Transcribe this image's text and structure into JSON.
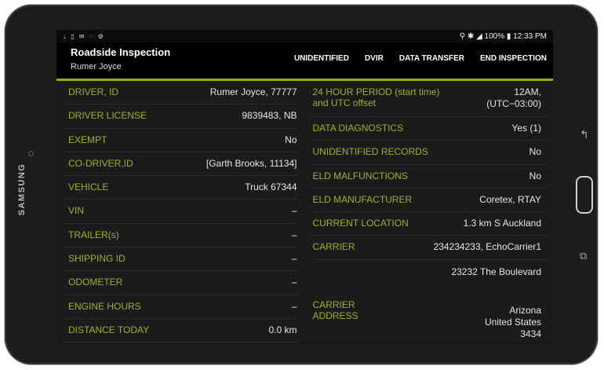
{
  "device": {
    "brand": "SAMSUNG"
  },
  "statusbar": {
    "left": "↓ ▯ ✉ ◌ ⚙",
    "right": "⚲ ✱ ὏6 ◢ 100% ▮ 12:33 PM"
  },
  "app": {
    "title": "Roadside Inspection",
    "subtitle": "Rumer Joyce",
    "actions": [
      "UNIDENTIFIED",
      "DVIR",
      "DATA TRANSFER",
      "END INSPECTION"
    ]
  },
  "left_rows": [
    {
      "label": "DRIVER, ID",
      "value": "Rumer Joyce, 77777"
    },
    {
      "label": "DRIVER LICENSE",
      "value": "9839483, NB"
    },
    {
      "label": "EXEMPT",
      "value": "No"
    },
    {
      "label": "CO-DRIVER,ID",
      "value": "[Garth Brooks, 11134]"
    },
    {
      "label": "VEHICLE",
      "value": "Truck 67344"
    },
    {
      "label": "VIN",
      "value": "–"
    },
    {
      "label": "TRAILER(s)",
      "value": "–"
    },
    {
      "label": "SHIPPING ID",
      "value": "–"
    },
    {
      "label": "ODOMETER",
      "value": "–"
    },
    {
      "label": "ENGINE HOURS",
      "value": "–"
    },
    {
      "label": "DISTANCE TODAY",
      "value": "0.0 km"
    }
  ],
  "right": {
    "period_label_1": "24 HOUR PERIOD (start time)",
    "period_label_2": "and UTC offset",
    "period_value_1": "12AM,",
    "period_value_2": "(UTC−03:00)",
    "rows": [
      {
        "label": "DATA DIAGNOSTICS",
        "value": "Yes (1)"
      },
      {
        "label": "UNIDENTIFIED RECORDS",
        "value": "No"
      },
      {
        "label": "ELD MALFUNCTIONS",
        "value": "No"
      },
      {
        "label": "ELD MANUFACTURER",
        "value": "Coretex, RTAY"
      },
      {
        "label": "CURRENT LOCATION",
        "value": "1.3 km S Auckland"
      },
      {
        "label": "CARRIER",
        "value": "234234233, EchoCarrier1"
      }
    ],
    "street": "23232 The Boulevard",
    "carrier_address_label_1": "CARRIER",
    "carrier_address_label_2": "ADDRESS",
    "addr_1": "Arizona",
    "addr_2": "United States",
    "addr_3": "3434"
  }
}
